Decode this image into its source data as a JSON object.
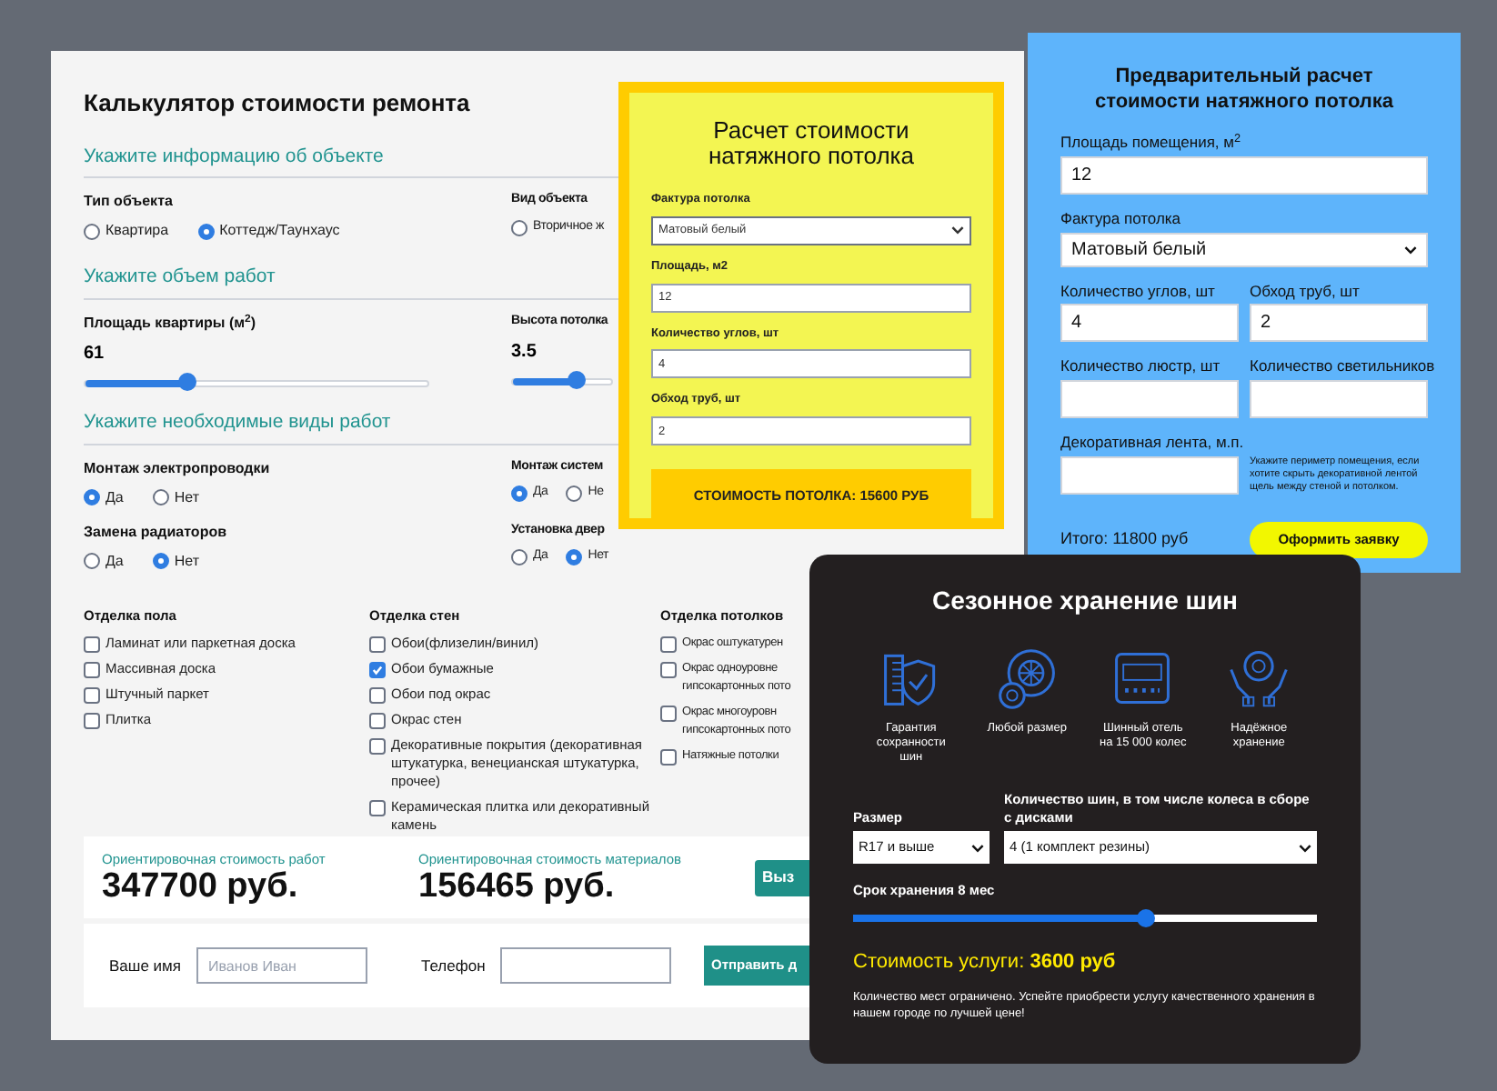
{
  "repair_calculator": {
    "title": "Калькулятор стоимости ремонта",
    "sections": [
      {
        "heading": "Укажите информацию об объекте",
        "fields": [
          {
            "kind": "radio",
            "label": "Тип объекта",
            "options": [
              {
                "label": "Квартира",
                "selected": false
              },
              {
                "label": "Коттедж/Таунхаус",
                "selected": true
              }
            ]
          },
          {
            "kind": "radio",
            "label": "Вид объекта",
            "options": [
              {
                "label": "Вторичное ж",
                "selected": false
              }
            ]
          }
        ]
      },
      {
        "heading": "Укажите объем работ",
        "fields": [
          {
            "kind": "slider",
            "label": "Площадь квартиры (м$^{2}$)",
            "value": "61",
            "level": 0.3
          },
          {
            "kind": "slider",
            "label": "Высота потолка",
            "value": "3.5",
            "level": 0.65
          }
        ]
      },
      {
        "heading": "Укажите необходимые виды работ",
        "fields": [
          {
            "kind": "radio",
            "label": "Монтаж электропроводки",
            "options": [
              {
                "label": "Да",
                "selected": true
              },
              {
                "label": "Нет",
                "selected": false
              }
            ]
          },
          {
            "kind": "radio",
            "label": "Монтаж систем",
            "options": [
              {
                "label": "Да",
                "selected": true
              },
              {
                "label": "Не",
                "selected": false
              }
            ]
          },
          {
            "kind": "radio",
            "label": "Замена радиаторов",
            "options": [
              {
                "label": "Да",
                "selected": false
              },
              {
                "label": "Нет",
                "selected": true
              }
            ]
          },
          {
            "kind": "radio",
            "label": "Установка двер",
            "options": [
              {
                "label": "Да",
                "selected": false
              },
              {
                "label": "Нет",
                "selected": true
              }
            ]
          }
        ]
      }
    ],
    "finishing": [
      {
        "heading": "Отделка пола",
        "items": [
          {
            "label": "Ламинат или паркетная доска",
            "checked": false
          },
          {
            "label": "Массивная доска",
            "checked": false
          },
          {
            "label": "Штучный паркет",
            "checked": false
          },
          {
            "label": "Плитка",
            "checked": false
          }
        ]
      },
      {
        "heading": "Отделка стен",
        "items": [
          {
            "label": "Обои(флизелин/винил)",
            "checked": false
          },
          {
            "label": "Обои бумажные",
            "checked": true
          },
          {
            "label": "Обои под окрас",
            "checked": false
          },
          {
            "label": "Окрас стен",
            "checked": false
          },
          {
            "label": "Декоративные покрытия (декоративная штукатурка, венецианская штукатурка, прочее)",
            "checked": false
          },
          {
            "label": "Керамическая плитка или декоративный камень",
            "checked": false
          }
        ]
      },
      {
        "heading": "Отделка потолков",
        "items": [
          {
            "label": "Окрас оштукатурен",
            "checked": false
          },
          {
            "label": "Окрас одноуровне гипсокартонных пото",
            "checked": false
          },
          {
            "label": "Окрас многоуровн гипсокартонных пото",
            "checked": false
          },
          {
            "label": "Натяжные потолки",
            "checked": false
          }
        ]
      }
    ],
    "totals": [
      {
        "label": "Ориентировочная стоимость работ",
        "value": "347700 руб."
      },
      {
        "label": "Ориентировочная стоимость материалов",
        "value": "156465 руб."
      }
    ],
    "totals_button": "Выз",
    "contact": {
      "name_label": "Ваше имя",
      "name_placeholder": "Иванов Иван",
      "phone_label": "Телефон",
      "button": "Отправить д"
    }
  },
  "ceiling_calculator": {
    "title": "Расчет стоимости натяжного потолка",
    "fields": [
      {
        "kind": "select",
        "label": "Фактура потолка",
        "value": "Матовый белый"
      },
      {
        "kind": "input",
        "label": "Площадь, м2",
        "value": "12"
      },
      {
        "kind": "input",
        "label": "Количество углов, шт",
        "value": "4"
      },
      {
        "kind": "input",
        "label": "Обход труб, шт",
        "value": "2"
      }
    ],
    "result": "СТОИМОСТЬ ПОТОЛКА: 15600 РУБ"
  },
  "ceiling_estimate": {
    "title": "Предварительный расчет стоимости натяжного потолка",
    "rows": [
      [
        {
          "kind": "input",
          "label": "Площадь помещения, м$^{2}$",
          "value": "12"
        }
      ],
      [
        {
          "kind": "select",
          "label": "Фактура потолка",
          "value": "Матовый белый"
        }
      ],
      [
        {
          "kind": "input",
          "label": "Количество углов, шт",
          "value": "4"
        },
        {
          "kind": "input",
          "label": "Обход труб, шт",
          "value": "2"
        }
      ],
      [
        {
          "kind": "input",
          "label": "Количество люстр, шт"
        },
        {
          "kind": "input",
          "label": "Количество светильников"
        }
      ],
      [
        {
          "kind": "input",
          "label": "Декоративная лента, м.п."
        },
        {
          "kind": "hint",
          "text": "Укажите периметр помещения, если хотите скрыть декоративной лентой щель между стеной и потолком."
        }
      ]
    ],
    "total": "Итого: 11800 руб",
    "button": "Оформить заявку"
  },
  "tire_storage": {
    "title": "Сезонное хранение шин",
    "features": [
      {
        "kind": "shield",
        "caption": "Гарантия сохранности шин"
      },
      {
        "kind": "tires",
        "caption": "Любой размер"
      },
      {
        "kind": "badge",
        "caption": "Шинный отель на 15 000 колес"
      },
      {
        "kind": "hands",
        "caption": "Надёжное хранение"
      }
    ],
    "size": {
      "label": "Размер",
      "value": "R17 и выше"
    },
    "count": {
      "label": "Количество шин, в том числе колеса в сборе с дисками",
      "value": "4 (1 комплект резины)"
    },
    "period": {
      "label": "Срок хранения 8 мес",
      "level": 0.63
    },
    "cost": "Стоимость услуги: **3600 руб**",
    "note": "Количество мест ограничено. Успейте приобрести услугу качественного хранения в нашем городе по лучшей цене!"
  }
}
